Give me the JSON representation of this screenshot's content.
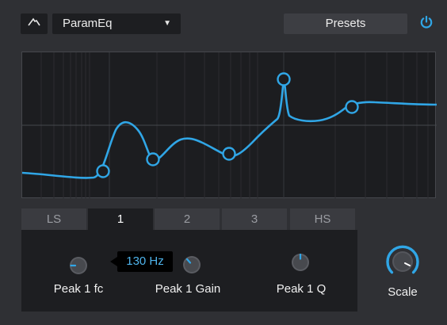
{
  "toolbar": {
    "eq_type_icon": "curve-icon",
    "preset_name": "ParamEq",
    "preset_caret": "▼",
    "presets_label": "Presets",
    "power_icon": "power-icon"
  },
  "graph": {
    "curve_color": "#30a6e6",
    "handle_color": "#30a6e6",
    "background": "#1c1d20",
    "band_handles": [
      "LS",
      "1",
      "2",
      "3",
      "HS"
    ]
  },
  "tabs": [
    {
      "label": "LS",
      "active": false
    },
    {
      "label": "1",
      "active": true
    },
    {
      "label": "2",
      "active": false
    },
    {
      "label": "3",
      "active": false
    },
    {
      "label": "HS",
      "active": false
    }
  ],
  "band": {
    "knobs": [
      {
        "label": "Peak 1 fc"
      },
      {
        "label": "Peak 1 Gain"
      },
      {
        "label": "Peak 1 Q"
      }
    ],
    "tooltip": "130 Hz"
  },
  "scale": {
    "label": "Scale",
    "accent": "#30a6e6"
  }
}
